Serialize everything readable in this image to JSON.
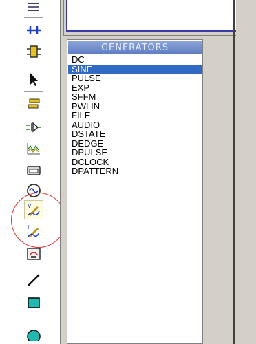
{
  "toolbar": {
    "tools": [
      {
        "name": "subcircuit-icon"
      },
      {
        "name": "bus-icon"
      },
      {
        "name": "component-icon"
      },
      {
        "name": "selection-arrow-icon"
      },
      {
        "name": "terminal-icon"
      },
      {
        "name": "port-icon"
      },
      {
        "name": "graph-icon"
      },
      {
        "name": "tape-icon"
      },
      {
        "name": "generator-icon"
      },
      {
        "name": "voltage-probe-icon"
      },
      {
        "name": "current-probe-icon"
      },
      {
        "name": "virtual-instrument-icon"
      },
      {
        "name": "line-icon"
      },
      {
        "name": "box-icon"
      }
    ],
    "highlighted_tool": "voltage-probe-icon"
  },
  "generators": {
    "title": "GENERATORS",
    "items": [
      {
        "label": "DC"
      },
      {
        "label": "SINE"
      },
      {
        "label": "PULSE"
      },
      {
        "label": "EXP"
      },
      {
        "label": "SFFM"
      },
      {
        "label": "PWLIN"
      },
      {
        "label": "FILE"
      },
      {
        "label": "AUDIO"
      },
      {
        "label": "DSTATE"
      },
      {
        "label": "DEDGE"
      },
      {
        "label": "DPULSE"
      },
      {
        "label": "DCLOCK"
      },
      {
        "label": "DPATTERN"
      }
    ],
    "selected": "SINE"
  },
  "colors": {
    "selection": "#316ac5",
    "header": "#5c7cc4",
    "annotation_circle": "#e03030",
    "panel": "#d4d0c8"
  }
}
